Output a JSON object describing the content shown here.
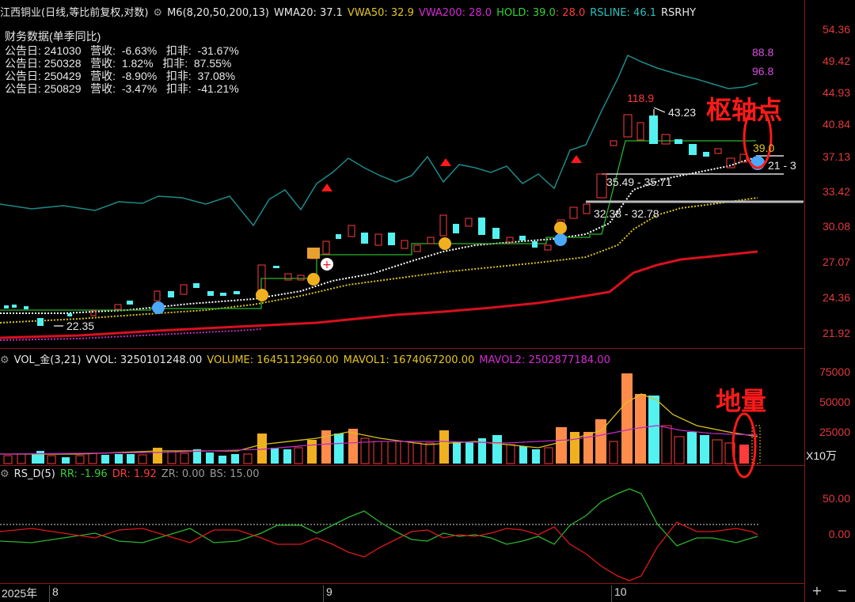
{
  "header_main": {
    "name": "江西铜业(日线,等比前复权,对数)",
    "m6": "M6(8,20,50,200,13)",
    "wma": "WMA20: 37.1",
    "vwa50": "VWA50: 32.9",
    "vwa200": "VWA200: 28.0",
    "hold": "HOLD: 39.0",
    "hold2": ": 28.0",
    "rsline": "RSLINE: 46.1",
    "rsrhy": "RSRHY"
  },
  "fin": {
    "title": "财务数据(单季同比)",
    "rows": [
      "公告日: 241030   营收:  -6.63%   扣非:  -31.67%",
      "公告日: 250328   营收:  1.82%   扣非:  87.55%",
      "公告日: 250429   营收:  -8.90%   扣非:  37.08%",
      "公告日: 250829   营收:  -3.47%   扣非:  -41.21%"
    ]
  },
  "yaxis_main": [
    "54.36",
    "49.42",
    "44.93",
    "40.84",
    "37.13",
    "33.42",
    "30.08",
    "27.07",
    "24.36",
    "21.92"
  ],
  "labels": {
    "rs_top1": "88.8",
    "rs_top2": "96.8",
    "high": "118.9",
    "arrow_val": "43.23",
    "hold_val": "39.0",
    "pivot_tag": "21 - 3",
    "range1": "35.49 - 35.71",
    "range2": "32.38 - 32.78",
    "low": "22.35"
  },
  "annotations": {
    "pivot": "枢轴点",
    "vol": "地量"
  },
  "header_vol": {
    "name": "VOL_金(3,21)",
    "vvol": "VVOL: 3250101248.00",
    "volume": "VOLUME: 1645112960.00",
    "mavol1": "MAVOL1: 1674067200.00",
    "mavol2": "MAVOL2: 2502877184.00"
  },
  "yaxis_vol": [
    "75000",
    "50000",
    "25000"
  ],
  "vol_unit": "X10万",
  "header_rs": {
    "name": "RS_D(5)",
    "rr": "RR: -1.96",
    "dr": "DR: 1.92",
    "zr": "ZR: 0.00",
    "bs": "BS: 15.00"
  },
  "yaxis_rs": [
    "50.00",
    "0.00"
  ],
  "xaxis": {
    "year": "2025年",
    "m8": "8",
    "m9": "9",
    "m10": "10"
  },
  "controls": {
    "zoom_in": "+",
    "zoom_out": "−"
  },
  "colors": {
    "up": "#ff3b3b",
    "down": "#54f1f1",
    "rsline": "#1e8a8a",
    "hold": "#2bb52b",
    "vwa50": "#d9c21a",
    "vwa200": "#e0122b",
    "wma": "#ffffff"
  }
}
